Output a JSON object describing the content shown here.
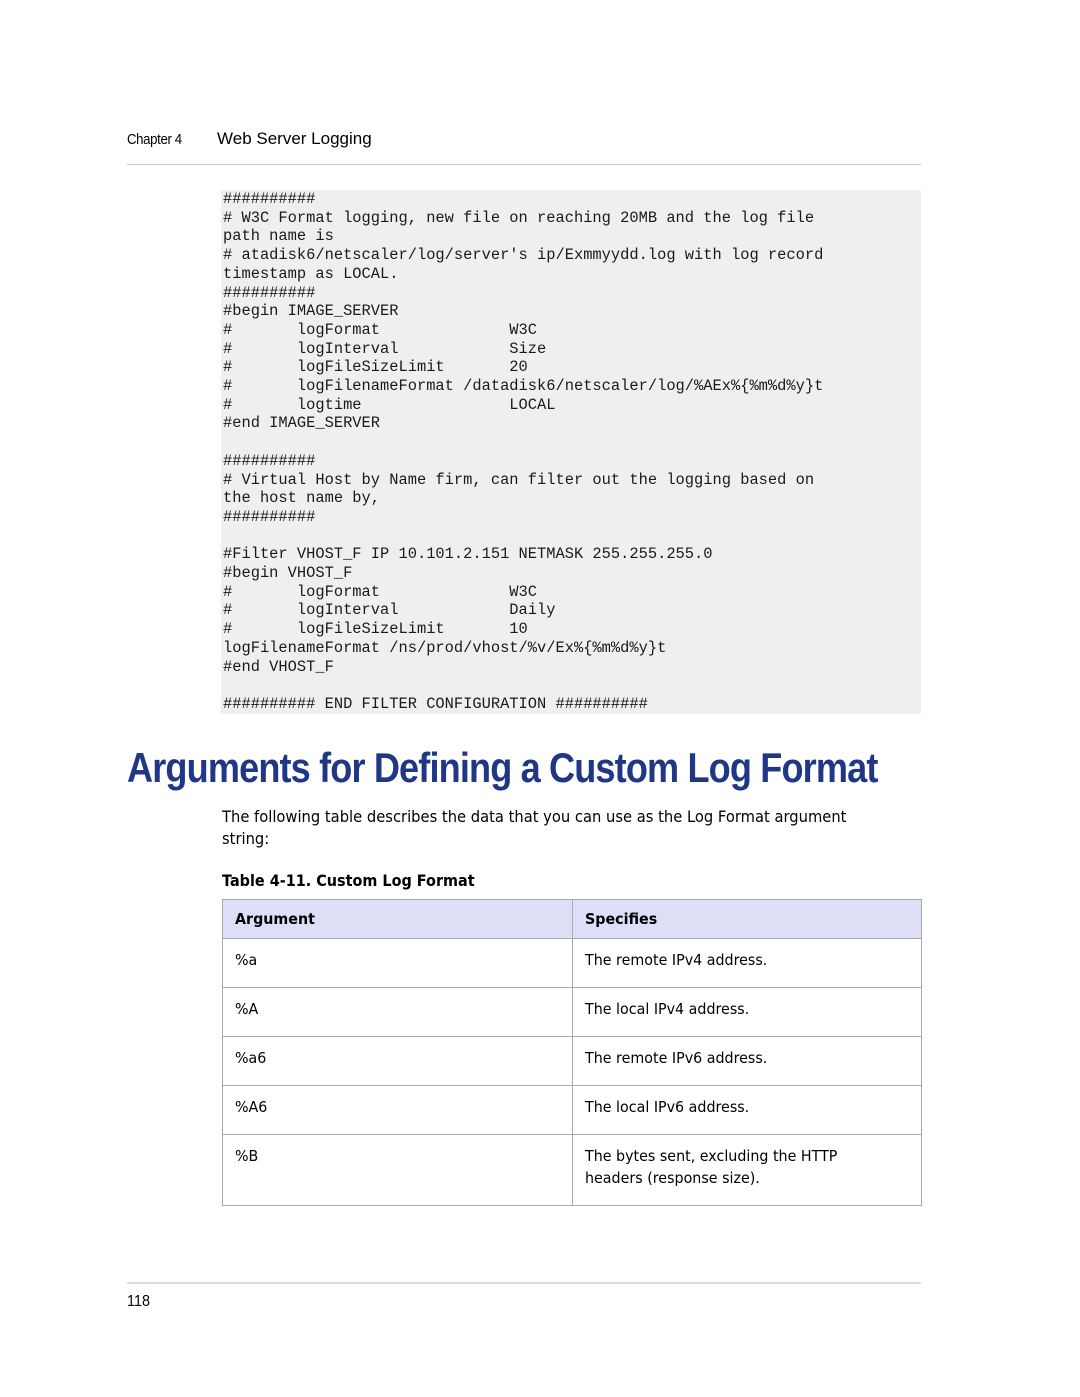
{
  "header": {
    "chapter_label": "Chapter 4",
    "chapter_title": "Web Server Logging"
  },
  "code_block": {
    "lines": [
      "##########",
      "# W3C Format logging, new file on reaching 20MB and the log file",
      "path name is",
      "# atadisk6/netscaler/log/server's ip/Exmmyydd.log with log record",
      "timestamp as LOCAL.",
      "##########",
      "#begin IMAGE_SERVER",
      "#       logFormat              W3C",
      "#       logInterval            Size",
      "#       logFileSizeLimit       20",
      "#       logFilenameFormat /datadisk6/netscaler/log/%AEx%{%m%d%y}t",
      "#       logtime                LOCAL",
      "#end IMAGE_SERVER",
      "",
      "##########",
      "# Virtual Host by Name firm, can filter out the logging based on",
      "the host name by,",
      "##########",
      "",
      "#Filter VHOST_F IP 10.101.2.151 NETMASK 255.255.255.0",
      "#begin VHOST_F",
      "#       logFormat              W3C",
      "#       logInterval            Daily",
      "#       logFileSizeLimit       10",
      "logFilenameFormat /ns/prod/vhost/%v/Ex%{%m%d%y}t",
      "#end VHOST_F",
      "",
      "########## END FILTER CONFIGURATION ##########"
    ]
  },
  "section": {
    "title": "Arguments for Defining a Custom Log Format",
    "intro_line1": "The following table describes the data that you can use as the Log Format argument",
    "intro_line2": "string:",
    "table_caption": "Table 4-11. Custom Log Format"
  },
  "table": {
    "headers": [
      "Argument",
      "Specifies"
    ],
    "rows": [
      {
        "argument": "%a",
        "specifies": [
          "The remote IPv4 address."
        ]
      },
      {
        "argument": "%A",
        "specifies": [
          "The local IPv4 address."
        ]
      },
      {
        "argument": "%a6",
        "specifies": [
          "The remote IPv6 address."
        ]
      },
      {
        "argument": "%A6",
        "specifies": [
          "The local IPv6 address."
        ]
      },
      {
        "argument": "%B",
        "specifies": [
          "The bytes sent, excluding the HTTP",
          "headers (response size)."
        ]
      }
    ]
  },
  "footer": {
    "page_number": "118"
  },
  "colors": {
    "title_blue": "#1f3784",
    "table_header_bg": "#dcdff5",
    "code_bg": "#efefef"
  }
}
